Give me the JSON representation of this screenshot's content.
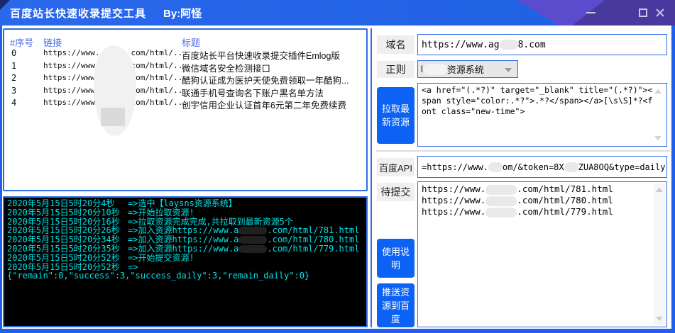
{
  "window": {
    "title": "百度站长快速收录提交工具",
    "byline": "By:阿怪"
  },
  "table": {
    "headers": {
      "index": "#序号",
      "link": "链接",
      "title": "标题"
    },
    "rows": [
      {
        "index": "0",
        "link_pre": "https://www.",
        "link_post": "com/html/...",
        "title": "百度站长平台快速收录提交插件Emlog版"
      },
      {
        "index": "1",
        "link_pre": "https://www.",
        "link_post": "com/html/...",
        "title": "微信域名安全检测接口"
      },
      {
        "index": "2",
        "link_pre": "https://www.",
        "link_post": "com/html/...",
        "title": "酷狗认证成为医护天使免费领取一年酷狗..."
      },
      {
        "index": "3",
        "link_pre": "https://www.",
        "link_post": "com/html/...",
        "title": "联通手机号查询名下账户黑名单方法"
      },
      {
        "index": "4",
        "link_pre": "https://www.",
        "link_post": "com/html/...",
        "title": "创宇信用企业认证首年6元第二年免费续费"
      }
    ]
  },
  "console": {
    "lines": [
      {
        "time": "2020年5月15日5时20分4秒",
        "msg": "=>选中【laysns资源系统】"
      },
      {
        "time": "2020年5月15日5时20分10秒",
        "msg": "=>开始拉取资源!"
      },
      {
        "time": "2020年5月15日5时20分16秒",
        "msg": "=>拉取资源完成完成,共拉取到最新资源5个"
      },
      {
        "time": "2020年5月15日5时20分26秒",
        "pre": "=>加入资源https://www.a",
        "post": ".com/html/781.html"
      },
      {
        "time": "2020年5月15日5时20分34秒",
        "pre": "=>加入资源https://www.a",
        "post": ".com/html/780.html"
      },
      {
        "time": "2020年5月15日5时20分35秒",
        "pre": "=>加入资源https://www.a",
        "post": ".com/html/779.html"
      },
      {
        "time": "2020年5月15日5时20分52秒",
        "msg": "=>开始提交资源!"
      },
      {
        "time": "2020年5月15日5时20分52秒",
        "msg": "=>"
      },
      {
        "full": true,
        "msg": "{\"remain\":0,\"success\":3,\"success_daily\":3,\"remain_daily\":0}"
      }
    ]
  },
  "form": {
    "domain_label": "域名",
    "domain_value_pre": "https://www.ag",
    "domain_value_post": "8.com",
    "regex_label": "正则",
    "regex_selected_pre": "l",
    "regex_selected_post": "资源系统",
    "pull_button": "拉取最新资源",
    "pattern": "<a href=\"(.*?)\" target=\"_blank\" title=\"(.*?)\"><span style=\"color:.*?\">.*?</span></a>[\\s\\S]*?<font class=\"new-time\">",
    "api_label": "百度API",
    "api_value_pre": "=https://www.",
    "api_value_mid": "om/&token=8X",
    "api_value_post": "ZUA8OQ&type=daily",
    "pending_label": "待提交",
    "pending_lines": [
      {
        "pre": "https://www.",
        "post": ".com/html/781.html"
      },
      {
        "pre": "https://www.",
        "post": ".com/html/780.html"
      },
      {
        "pre": "https://www.",
        "post": ".com/html/779.html"
      }
    ],
    "help_button": "使用说明",
    "push_button": "推送资源到百度"
  }
}
